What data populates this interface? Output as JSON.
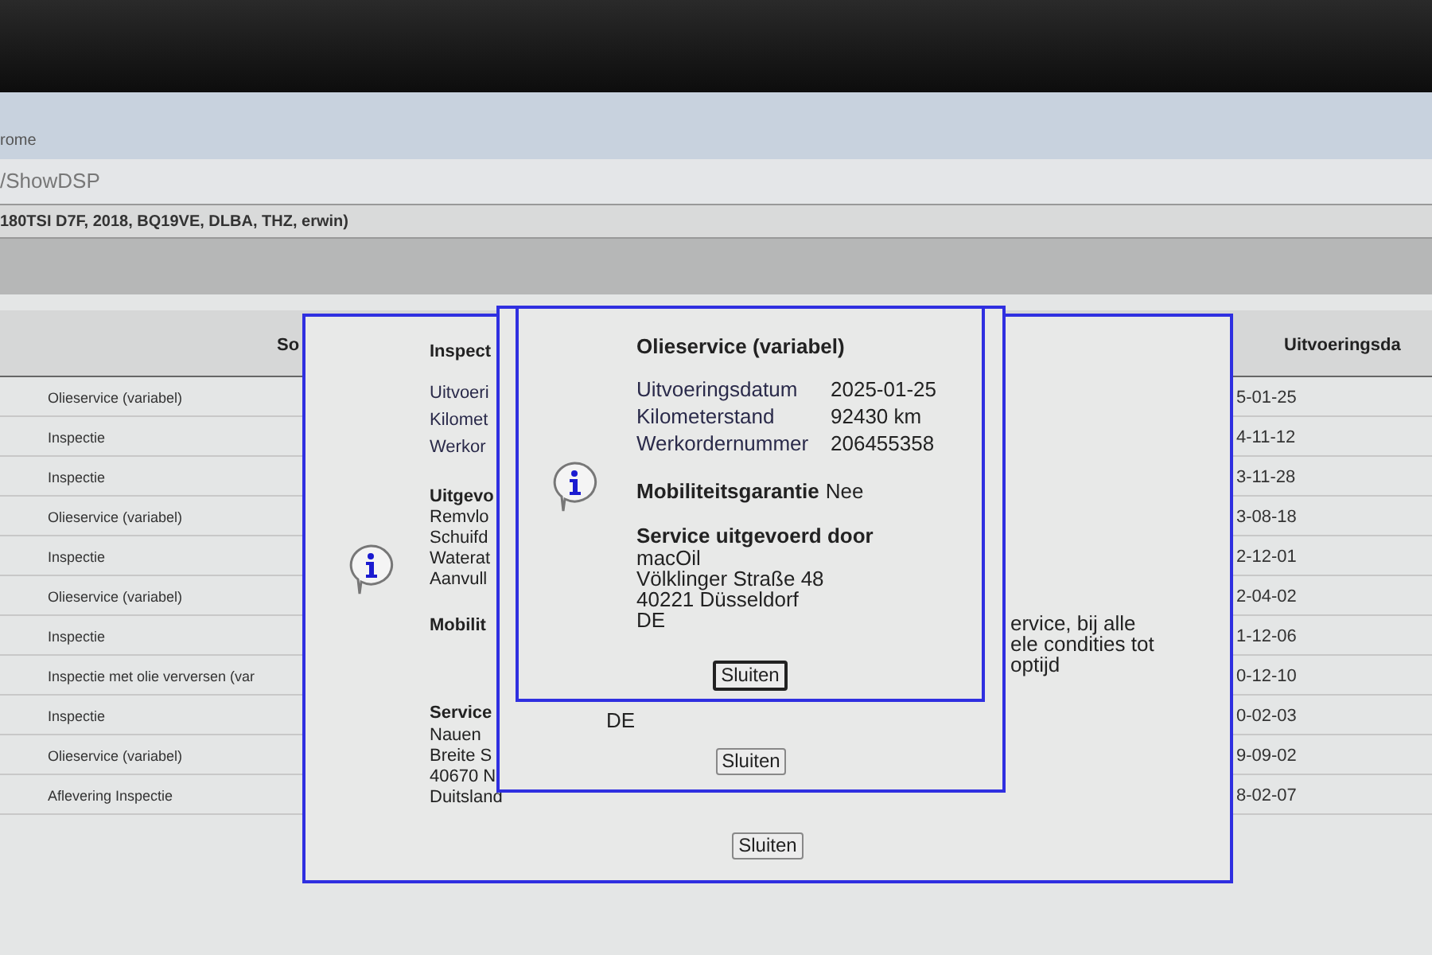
{
  "browser": {
    "title": "rome",
    "address": "/ShowDSP"
  },
  "vehicle_header": "180TSI D7F, 2018, BQ19VE, DLBA, THZ, erwin)",
  "table": {
    "columns": [
      "So",
      "Uitvoeringsda"
    ],
    "rows": [
      {
        "service": "Olieservice (variabel)",
        "date": "5-01-25"
      },
      {
        "service": "Inspectie",
        "date": "4-11-12"
      },
      {
        "service": "Inspectie",
        "date": "3-11-28"
      },
      {
        "service": "Olieservice (variabel)",
        "date": "3-08-18"
      },
      {
        "service": "Inspectie",
        "date": "2-12-01"
      },
      {
        "service": "Olieservice (variabel)",
        "date": "2-04-02"
      },
      {
        "service": "Inspectie",
        "date": "1-12-06"
      },
      {
        "service": "Inspectie met olie verversen (var",
        "date": "0-12-10"
      },
      {
        "service": "Inspectie",
        "date": "0-02-03"
      },
      {
        "service": "Olieservice (variabel)",
        "date": "9-09-02"
      },
      {
        "service": "Aflevering Inspectie",
        "date": "8-02-07"
      }
    ]
  },
  "back_dialog": {
    "title": "Inspect",
    "details": [
      {
        "label": "Uitvoeri"
      },
      {
        "label": "Kilomet"
      },
      {
        "label": "Werkor"
      }
    ],
    "work_heading": "Uitgevo",
    "work_items": [
      "Remvlo",
      "Schuifd",
      "Waterat",
      "Aanvull"
    ],
    "mobility_label": "Mobilit",
    "mobility_value": [
      "ervice, bij alle",
      "ele condities tot",
      "optijd"
    ],
    "provider_heading": "Service",
    "provider_lines": [
      "Nauen",
      "Breite S",
      "40670 N",
      "Duitsland"
    ],
    "button": "Sluiten",
    "focused": false
  },
  "middle_dialog": {
    "provider_lines": [
      "DE"
    ],
    "button": "Sluiten",
    "focused": false
  },
  "front_dialog": {
    "title": "Olieservice (variabel)",
    "details": [
      {
        "label": "Uitvoeringsdatum",
        "value": "2025-01-25"
      },
      {
        "label": "Kilometerstand",
        "value": "92430 km"
      },
      {
        "label": "Werkordernummer",
        "value": "206455358"
      }
    ],
    "mobility_label": "Mobiliteitsgarantie",
    "mobility_value": [
      "Nee"
    ],
    "provider_heading": "Service uitgevoerd door",
    "provider_lines": [
      "macOil",
      "Völklinger Straße 48",
      "40221 Düsseldorf",
      "DE"
    ],
    "button": "Sluiten",
    "focused": true
  }
}
